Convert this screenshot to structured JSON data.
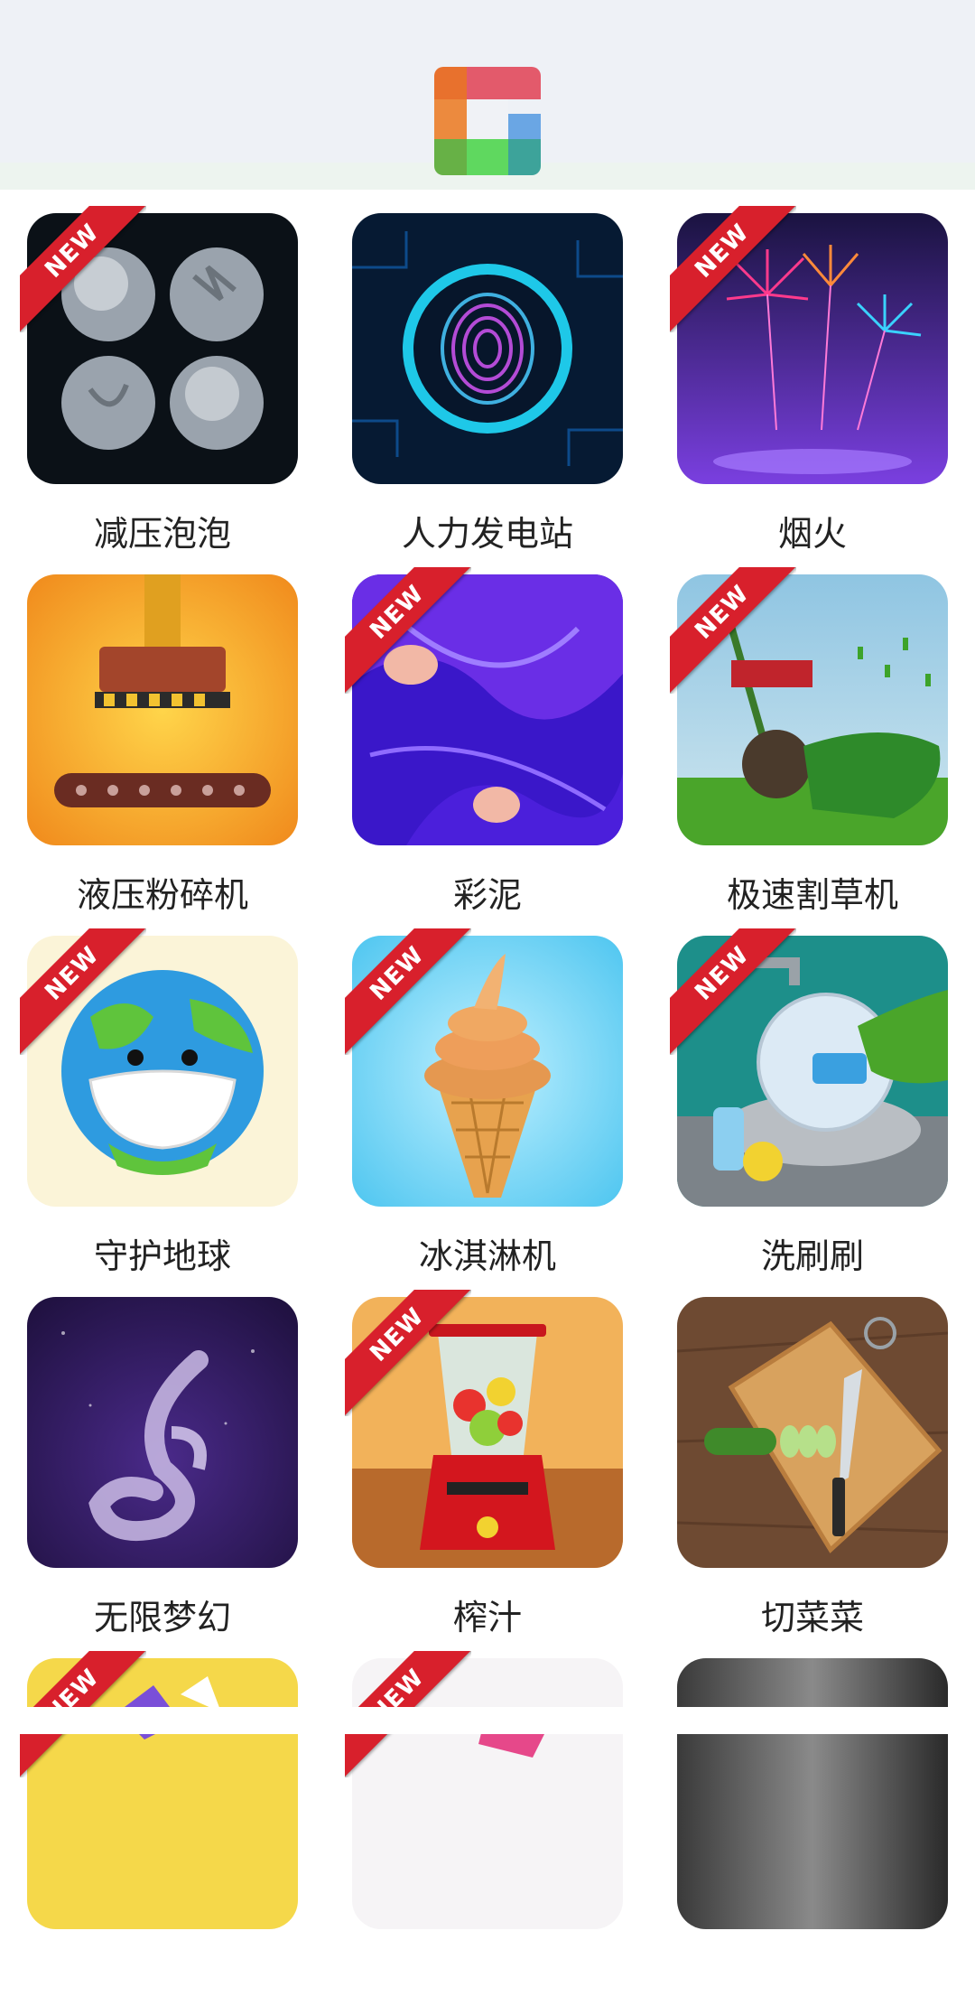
{
  "header": {
    "logo_icon": "app-logo-icon",
    "logo_colors": [
      "#e8712d",
      "#e35a6b",
      "#e86f7a",
      "#6aa6e4",
      "#67b146",
      "#5fd85f",
      "#3da39a"
    ]
  },
  "ribbon_text": "NEW",
  "games": [
    {
      "label": "减压泡泡",
      "icon": "bubble-wrap-icon",
      "is_new": true
    },
    {
      "label": "人力发电站",
      "icon": "fingerprint-icon",
      "is_new": false
    },
    {
      "label": "烟火",
      "icon": "fireworks-icon",
      "is_new": true
    },
    {
      "label": "液压粉碎机",
      "icon": "hydraulic-crusher-icon",
      "is_new": false
    },
    {
      "label": "彩泥",
      "icon": "slime-icon",
      "is_new": true
    },
    {
      "label": "极速割草机",
      "icon": "lawn-mower-icon",
      "is_new": true
    },
    {
      "label": "守护地球",
      "icon": "earth-mask-icon",
      "is_new": true
    },
    {
      "label": "冰淇淋机",
      "icon": "ice-cream-icon",
      "is_new": true
    },
    {
      "label": "洗刷刷",
      "icon": "dish-washing-icon",
      "is_new": true
    },
    {
      "label": "无限梦幻",
      "icon": "smoke-swirl-icon",
      "is_new": false
    },
    {
      "label": "榨汁",
      "icon": "blender-icon",
      "is_new": true
    },
    {
      "label": "切菜菜",
      "icon": "cutting-board-icon",
      "is_new": false
    },
    {
      "label": "",
      "icon": "partial-yellow-icon",
      "is_new": true
    },
    {
      "label": "",
      "icon": "partial-pink-icon",
      "is_new": true
    },
    {
      "label": "",
      "icon": "partial-gray-icon",
      "is_new": false
    }
  ]
}
